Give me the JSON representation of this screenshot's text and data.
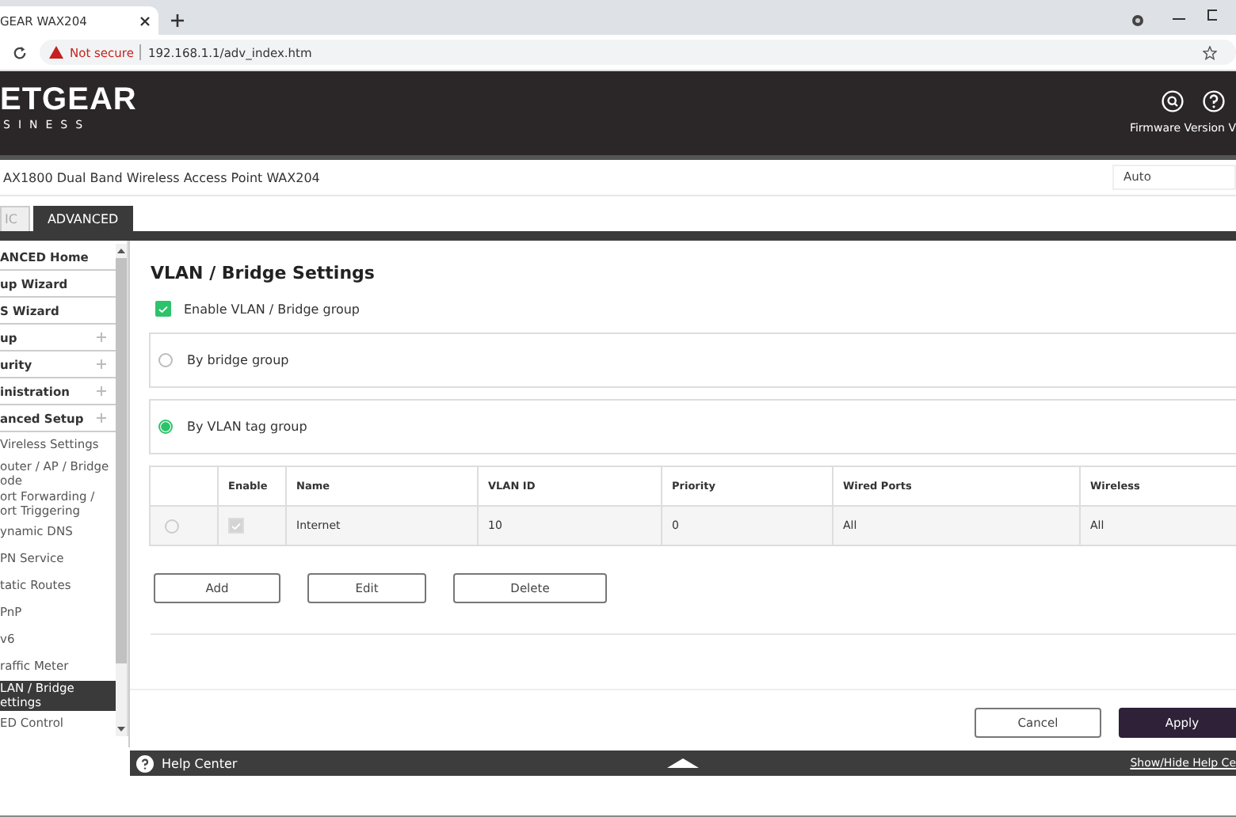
{
  "browser": {
    "tab_title": "GEAR WAX204",
    "warning": "Not secure",
    "url": "192.168.1.1/adv_index.htm"
  },
  "header": {
    "logo": "ETGEAR",
    "logo_sub": "SINESS",
    "firmware": "Firmware Version V"
  },
  "product": {
    "name": "AX1800 Dual Band Wireless Access Point WAX204",
    "mode": "Auto"
  },
  "top_tabs": [
    {
      "label": "IC",
      "selected": false
    },
    {
      "label": "ADVANCED",
      "selected": true
    }
  ],
  "sidebar": {
    "items": [
      {
        "label": "ANCED Home",
        "kind": "section",
        "expandable": false,
        "selected": false
      },
      {
        "label": "up Wizard",
        "kind": "section",
        "expandable": false,
        "selected": false
      },
      {
        "label": "S Wizard",
        "kind": "section",
        "expandable": false,
        "selected": false
      },
      {
        "label": "up",
        "kind": "section",
        "expandable": true,
        "selected": false
      },
      {
        "label": "urity",
        "kind": "section",
        "expandable": true,
        "selected": false
      },
      {
        "label": "inistration",
        "kind": "section",
        "expandable": true,
        "selected": false
      },
      {
        "label": "anced Setup",
        "kind": "section",
        "expandable": true,
        "selected": false
      },
      {
        "label": "Vireless Settings",
        "kind": "sub",
        "selected": false
      },
      {
        "label": "outer / AP / Bridge\node",
        "kind": "sub",
        "selected": false
      },
      {
        "label": "ort Forwarding /\nort Triggering",
        "kind": "sub",
        "selected": false
      },
      {
        "label": "ynamic DNS",
        "kind": "sub",
        "selected": false
      },
      {
        "label": "PN Service",
        "kind": "sub",
        "selected": false
      },
      {
        "label": "tatic Routes",
        "kind": "sub",
        "selected": false
      },
      {
        "label": "PnP",
        "kind": "sub",
        "selected": false
      },
      {
        "label": "v6",
        "kind": "sub",
        "selected": false
      },
      {
        "label": "raffic Meter",
        "kind": "sub",
        "selected": false
      },
      {
        "label": "LAN / Bridge\nettings",
        "kind": "sub",
        "selected": true
      },
      {
        "label": "ED Control",
        "kind": "sub",
        "selected": false
      }
    ]
  },
  "page": {
    "title": "VLAN / Bridge Settings",
    "enable": {
      "label": "Enable VLAN / Bridge group",
      "checked": true
    },
    "modes": [
      {
        "label": "By bridge group",
        "selected": false
      },
      {
        "label": "By VLAN tag group",
        "selected": true
      }
    ],
    "table": {
      "columns": [
        "",
        "Enable",
        "Name",
        "VLAN ID",
        "Priority",
        "Wired Ports",
        "Wireless"
      ],
      "rows": [
        {
          "selected": false,
          "enabled": true,
          "cells": [
            "",
            "",
            "Internet",
            "10",
            "0",
            "All",
            "All"
          ]
        }
      ]
    },
    "actions": [
      "Add",
      "Edit",
      "Delete"
    ],
    "footer_buttons": [
      {
        "label": "Cancel",
        "kind": "secondary"
      },
      {
        "label": "Apply",
        "kind": "primary"
      }
    ]
  },
  "help_bar": {
    "label": "Help Center",
    "link": "Show/Hide Help Ce"
  }
}
